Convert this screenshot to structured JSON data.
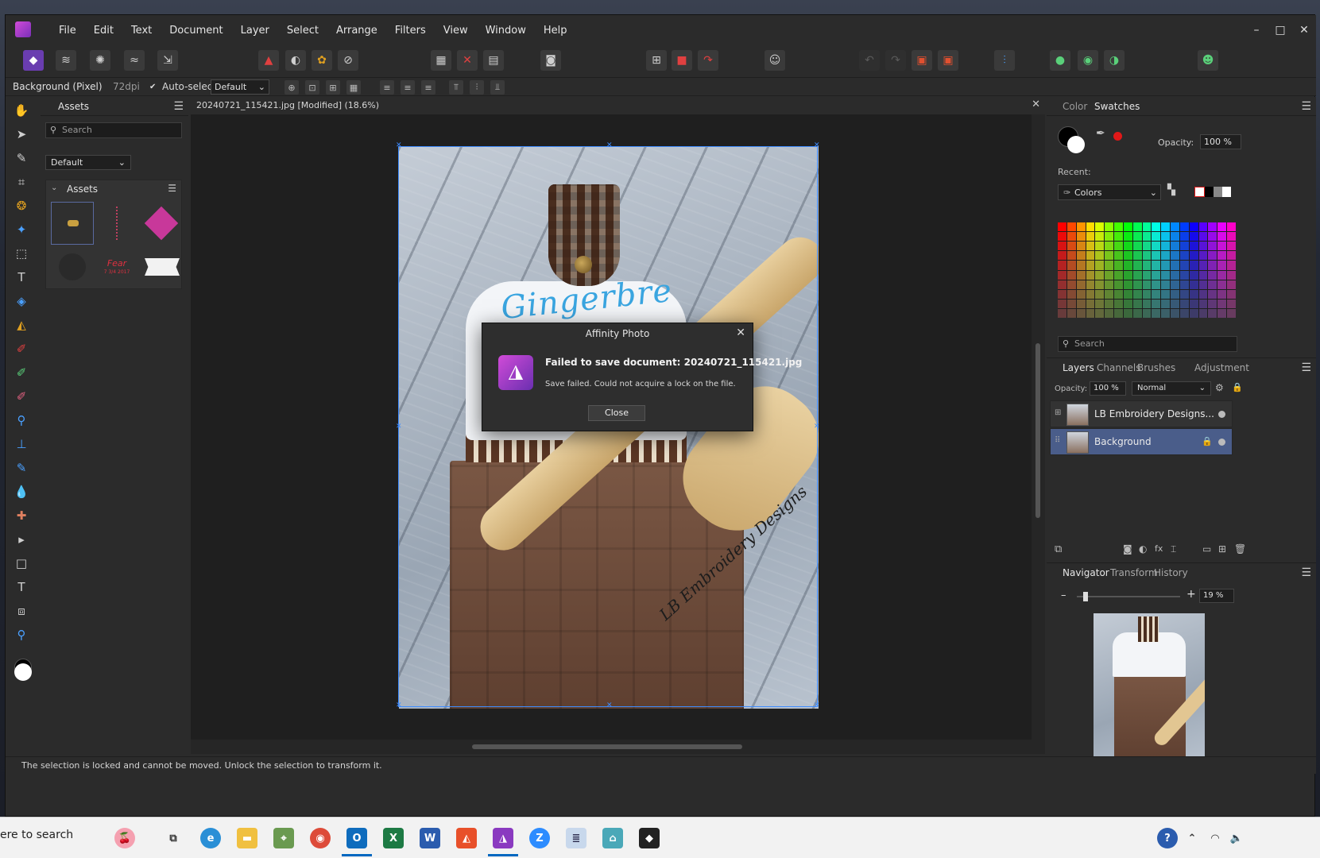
{
  "menubar": {
    "items": [
      "File",
      "Edit",
      "Text",
      "Document",
      "Layer",
      "Select",
      "Arrange",
      "Filters",
      "View",
      "Window",
      "Help"
    ],
    "window_controls": {
      "minimize": "–",
      "maximize": "□",
      "close": "✕"
    }
  },
  "context": {
    "layer_label": "Background (Pixel)",
    "dpi": "72dpi",
    "autoselect_label": "Auto-select:",
    "autoselect_value": "Default"
  },
  "assets_panel": {
    "tab": "Assets",
    "search_placeholder": "Search",
    "category": "Default",
    "group_title": "Assets",
    "asset_sample_text": "Fear",
    "asset_sample_subtext": "7 3/4 2017"
  },
  "document": {
    "title": "20240721_115421.jpg [Modified] (18.6%)",
    "embroidery_text": "Gingerbre",
    "spoon_text": "LB Embroidery Designs"
  },
  "dialog": {
    "title": "Affinity Photo",
    "heading": "Failed to save document: 20240721_115421.jpg",
    "message": "Save failed. Could not acquire a lock on the file.",
    "close_button": "Close"
  },
  "color_panel": {
    "tabs": [
      "Color",
      "Swatches"
    ],
    "active_tab": "Swatches",
    "opacity_label": "Opacity:",
    "opacity_value": "100 %",
    "recent_label": "Recent:",
    "palette_name": "Colors",
    "search_placeholder": "Search"
  },
  "layers_panel": {
    "tabs": [
      "Layers",
      "Channels",
      "Brushes",
      "Adjustment"
    ],
    "opacity_label": "Opacity:",
    "opacity_value": "100 %",
    "blend_mode": "Normal",
    "layers": [
      {
        "name": "LB Embroidery Designs...",
        "selected": false,
        "locked": false
      },
      {
        "name": "Background",
        "selected": true,
        "locked": true
      }
    ]
  },
  "navigator_panel": {
    "tabs": [
      "Navigator",
      "Transform",
      "History"
    ],
    "zoom_value": "19 %",
    "minus": "–",
    "plus": "+"
  },
  "statusbar": {
    "text": "The selection is locked and cannot be moved. Unlock the selection to transform it."
  },
  "taskbar": {
    "search_text": "ere to search",
    "apps": [
      "Task View",
      "Edge",
      "File Explorer",
      "Maps",
      "Chrome",
      "Outlook",
      "Excel",
      "Word",
      "Affinity Designer",
      "Affinity Photo",
      "Zoom",
      "Notepad",
      "Affinity Publisher",
      "Roblox"
    ]
  },
  "colors": {
    "accent": "#6a3db0",
    "selection": "#3d8bff",
    "layer_selected": "#4a5d8a"
  }
}
